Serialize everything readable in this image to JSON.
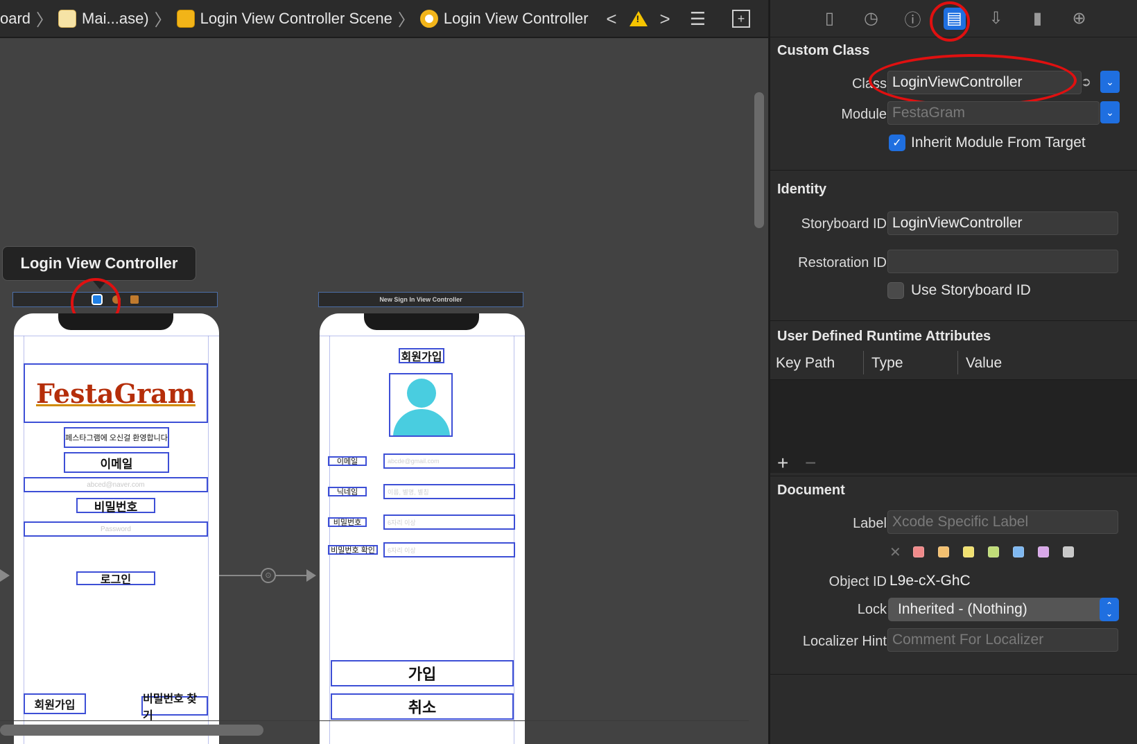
{
  "jumpbar": {
    "crumbs": [
      "oard",
      "Mai...ase)",
      "Login View Controller Scene",
      "Login View Controller"
    ]
  },
  "canvas": {
    "scene_tooltip": "Login View Controller",
    "second_scene_title": "New Sign In View Controller",
    "login": {
      "logo": "FestaGram",
      "welcome": "페스타그램에 오신걸 환영합니다",
      "email_label": "이메일",
      "email_placeholder": "abced@naver.com",
      "password_label": "비밀번호",
      "password_placeholder": "Password",
      "login_button": "로그인",
      "signup_button": "회원가입",
      "find_password_button": "비밀번호 찾기"
    },
    "signup": {
      "title": "회원가입",
      "email_label": "이메일",
      "email_placeholder": "abcde@gmail.com",
      "nickname_label": "닉네임",
      "nickname_placeholder": "이름, 별명, 별칭",
      "password_label": "비밀번호",
      "password_placeholder": "6자리 이상",
      "password_confirm_label": "비밀번호 확인",
      "password_confirm_placeholder": "6자리 이상",
      "join_button": "가입",
      "cancel_button": "취소"
    }
  },
  "inspector": {
    "custom_class": {
      "title": "Custom Class",
      "class_label": "Class",
      "class_value": "LoginViewController",
      "module_label": "Module",
      "module_value": "FestaGram",
      "inherit_label": "Inherit Module From Target",
      "inherit_checked": true
    },
    "identity": {
      "title": "Identity",
      "storyboard_id_label": "Storyboard ID",
      "storyboard_id_value": "LoginViewController",
      "restoration_id_label": "Restoration ID",
      "restoration_id_value": "",
      "use_storyboard_id_label": "Use Storyboard ID",
      "use_storyboard_id_checked": false
    },
    "udra": {
      "title": "User Defined Runtime Attributes",
      "columns": [
        "Key Path",
        "Type",
        "Value"
      ]
    },
    "document": {
      "title": "Document",
      "label_label": "Label",
      "label_placeholder": "Xcode Specific Label",
      "swatches": [
        "#f08a8a",
        "#f3c070",
        "#f0e070",
        "#c0dc78",
        "#7fb8f0",
        "#d8a8e8",
        "#c8c8c8"
      ],
      "object_id_label": "Object ID",
      "object_id_value": "L9e-cX-GhC",
      "lock_label": "Lock",
      "lock_value": "Inherited - (Nothing)",
      "localizer_label": "Localizer Hint",
      "localizer_placeholder": "Comment For Localizer"
    }
  }
}
